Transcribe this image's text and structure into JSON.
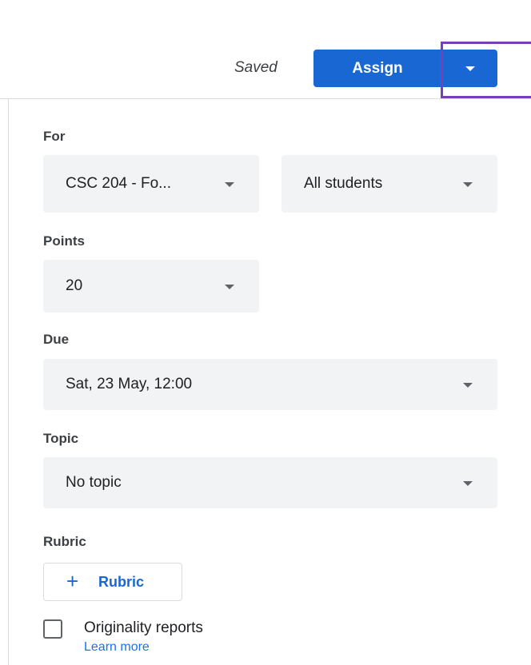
{
  "header": {
    "saved_text": "Saved",
    "assign_label": "Assign"
  },
  "form": {
    "for_label": "For",
    "class_value": "CSC 204 - Fo...",
    "students_value": "All students",
    "points_label": "Points",
    "points_value": "20",
    "due_label": "Due",
    "due_value": "Sat, 23 May, 12:00",
    "topic_label": "Topic",
    "topic_value": "No topic",
    "rubric_label": "Rubric",
    "rubric_button": "Rubric",
    "originality_label": "Originality reports",
    "learn_more": "Learn more"
  },
  "colors": {
    "primary": "#1967d2",
    "highlight": "#7b3fb5",
    "field_bg": "#f1f3f4"
  },
  "icons": {
    "dropdown": "caret-down-icon",
    "add": "plus-icon"
  }
}
